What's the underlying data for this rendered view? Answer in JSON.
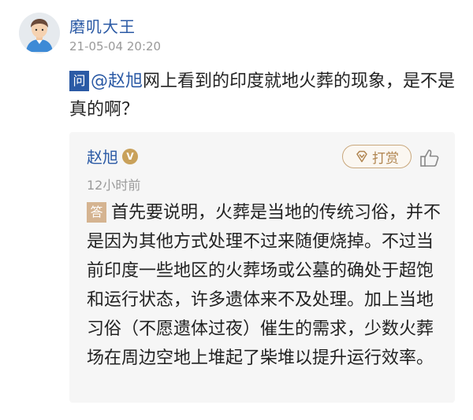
{
  "post": {
    "user_name": "磨叽大王",
    "time": "21-05-04 20:20",
    "question_badge": "问",
    "mention": "@赵旭",
    "question_text": "网上看到的印度就地火葬的现象，是不是真的啊？"
  },
  "answer": {
    "name": "赵旭",
    "verified_badge": "V",
    "reward_label": "打赏",
    "time": "12小时前",
    "answer_badge": "答",
    "text": "首先要说明，火葬是当地的传统习俗，并不是因为其他方式处理不过来随便烧掉。不过当前印度一些地区的火葬场或公墓的确处于超饱和运行状态，许多遗体来不及处理。加上当地习俗（不愿遗体过夜）催生的需求，少数火葬场在周边空地上堆起了柴堆以提升运行效率。"
  },
  "colors": {
    "link_blue": "#2b5aa5",
    "gold": "#c9a15a",
    "card_bg": "#f6f6f6"
  }
}
